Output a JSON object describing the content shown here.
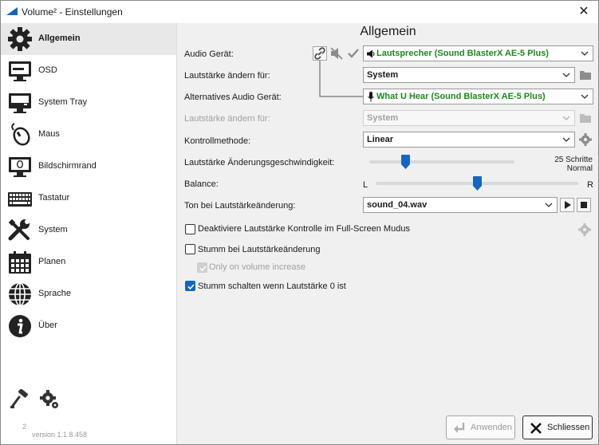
{
  "window": {
    "title": "Volume² - Einstellungen",
    "close_glyph": "✕"
  },
  "sidebar": {
    "items": [
      {
        "label": "Allgemein",
        "icon": "gear-icon"
      },
      {
        "label": "OSD",
        "icon": "monitor-icon"
      },
      {
        "label": "System Tray",
        "icon": "system-tray-icon"
      },
      {
        "label": "Maus",
        "icon": "mouse-icon"
      },
      {
        "label": "Bildschirmrand",
        "icon": "screen-edge-icon"
      },
      {
        "label": "Tastatur",
        "icon": "keyboard-icon"
      },
      {
        "label": "System",
        "icon": "tools-icon"
      },
      {
        "label": "Planen",
        "icon": "calendar-icon"
      },
      {
        "label": "Sprache",
        "icon": "globe-icon"
      },
      {
        "label": "Über",
        "icon": "info-icon"
      }
    ],
    "version_mark": "2",
    "version": "version 1.1.8.458"
  },
  "main": {
    "title": "Allgemein",
    "audio_device": {
      "label": "Audio Gerät:",
      "value": "Lautsprecher (Sound BlasterX AE-5 Plus)"
    },
    "change_volume_for": {
      "label": "Lautstärke ändern für:",
      "value": "System"
    },
    "alt_audio_device": {
      "label": "Alternatives Audio Gerät:",
      "value": "What U Hear (Sound BlasterX AE-5 Plus)"
    },
    "alt_change_volume_for": {
      "label": "Lautstärke ändern für:",
      "value": "System"
    },
    "control_method": {
      "label": "Kontrollmethode:",
      "value": "Linear"
    },
    "change_speed": {
      "label": "Lautstärke Änderungsgeschwindigkeit:",
      "steps": "25 Schritte",
      "mode": "Normal",
      "position": 0.25
    },
    "balance": {
      "label": "Balance:",
      "left": "L",
      "right": "R",
      "position": 0.5
    },
    "sound_on_change": {
      "label": "Ton bei Lautstärkeänderung:",
      "value": "sound_04.wav"
    },
    "checkboxes": [
      {
        "label": "Deaktiviere Lautstärke Kontrolle im Full-Screen Mudus",
        "checked": false,
        "disabled": false
      },
      {
        "label": "Stumm bei Lautstärkeänderung",
        "checked": false,
        "disabled": false
      },
      {
        "label": "Only on volume increase",
        "checked": true,
        "disabled": true
      },
      {
        "label": "Stumm schalten wenn Lautstärke 0 ist",
        "checked": true,
        "disabled": false
      }
    ]
  },
  "buttons": {
    "apply": "Anwenden",
    "close": "Schliessen"
  },
  "colors": {
    "accent": "#1565c0",
    "green_text": "#1b8a1b",
    "selected_nav": "#e8e8e8"
  }
}
